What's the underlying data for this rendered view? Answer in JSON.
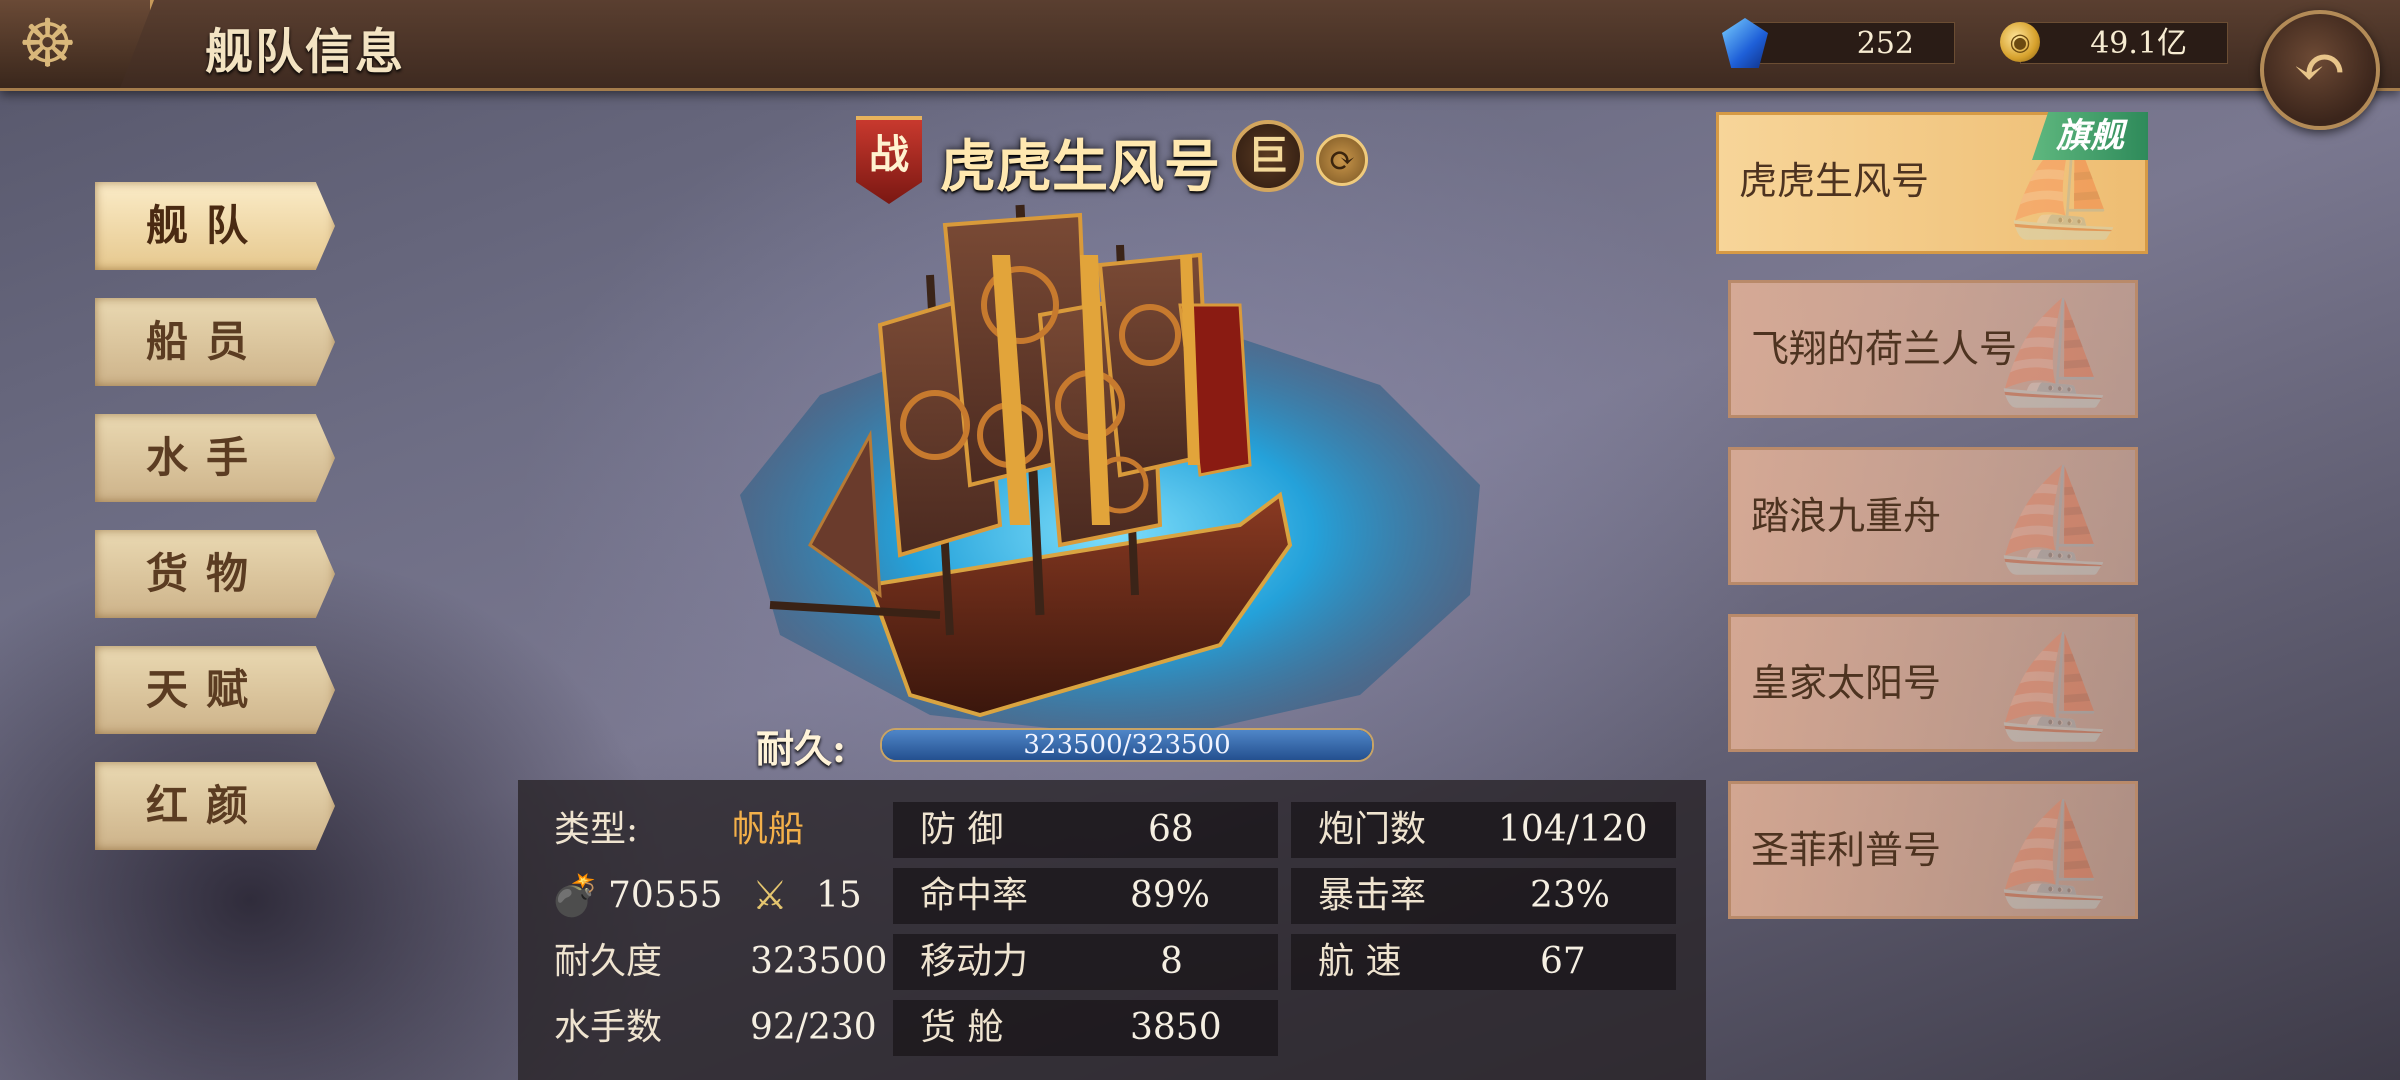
{
  "header": {
    "title": "舰队信息",
    "gems": "252",
    "gold": "49.1亿",
    "wheel_icon": "ship-wheel-icon",
    "back_icon": "back-arrow-icon"
  },
  "tabs": [
    {
      "label": "舰队",
      "active": true
    },
    {
      "label": "船员",
      "active": false
    },
    {
      "label": "水手",
      "active": false
    },
    {
      "label": "货物",
      "active": false
    },
    {
      "label": "天赋",
      "active": false
    },
    {
      "label": "红颜",
      "active": false
    }
  ],
  "ship": {
    "badge": "战",
    "name": "虎虎生风号",
    "size_badge": "巨",
    "durability_label": "耐久:",
    "durability_text": "323500/323500",
    "durability_fraction": 1.0
  },
  "stats": {
    "type_label": "类型:",
    "type_value": "帆船",
    "cannon_power": "70555",
    "melee_power": "15",
    "durability_label": "耐久度",
    "durability_value": "323500",
    "sailors_label": "水手数",
    "sailors_value": "92/230",
    "defense_label": "防 御",
    "defense_value": "68",
    "hit_label": "命中率",
    "hit_value": "89%",
    "move_label": "移动力",
    "move_value": "8",
    "cargo_label": "货 舱",
    "cargo_value": "3850",
    "gunports_label": "炮门数",
    "gunports_value": "104/120",
    "crit_label": "暴击率",
    "crit_value": "23%",
    "speed_label": "航 速",
    "speed_value": "67"
  },
  "fleet": {
    "flagship_tag": "旗舰",
    "ships": [
      "虎虎生风号",
      "飞翔的荷兰人号",
      "踏浪九重舟",
      "皇家太阳号",
      "圣菲利普号"
    ]
  },
  "colors": {
    "accent_gold": "#d3a65e",
    "type_orange": "#f3b04a",
    "flagship_green": "#2e8a5a",
    "durability_blue": "#24508f"
  }
}
